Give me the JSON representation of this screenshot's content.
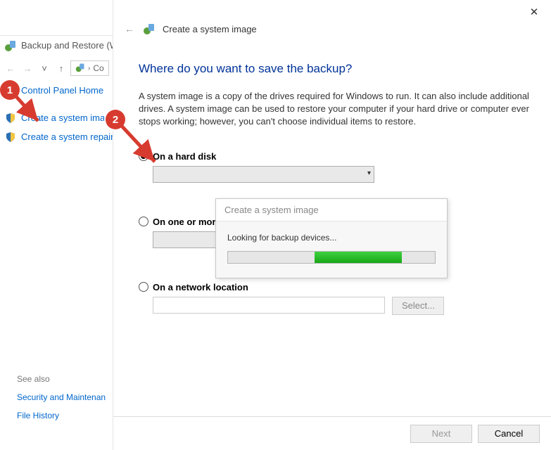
{
  "bg": {
    "title": "Backup and Restore (W",
    "addr_frag": "Co",
    "cp_home": "Control Panel Home",
    "link_create_image": "Create a system image",
    "link_create_repair": "Create a system repair",
    "see_also": "See also",
    "link_security": "Security and Maintenan",
    "link_filehist": "File History"
  },
  "wizard": {
    "header": "Create a system image",
    "title": "Where do you want to save the backup?",
    "desc": "A system image is a copy of the drives required for Windows to run. It can also include additional drives. A system image can be used to restore your computer if your hard drive or computer ever stops working; however, you can't choose individual items to restore.",
    "opt_disk": "On a hard disk",
    "opt_dvd": "On one or more",
    "opt_net": "On a network location",
    "select_btn": "Select...",
    "next_btn": "Next",
    "cancel_btn": "Cancel"
  },
  "scan": {
    "title": "Create a system image",
    "msg": "Looking for backup devices..."
  },
  "callouts": {
    "one": "1",
    "two": "2"
  }
}
